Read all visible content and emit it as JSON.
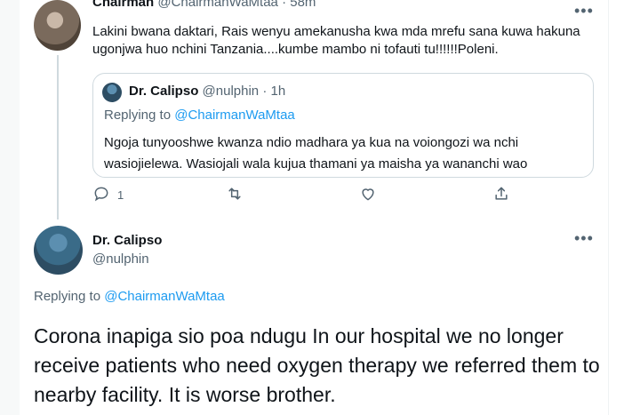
{
  "top_tweet": {
    "author_name": "Chairman",
    "author_handle": "@ChairmanWaMtaa",
    "separator": "·",
    "time": "58m",
    "text": "Lakini bwana daktari, Rais wenyu amekanusha kwa mda mrefu sana kuwa hakuna ugonjwa huo nchini Tanzania....kumbe mambo ni tofauti tu!!!!!!Poleni.",
    "more": "•••"
  },
  "quote": {
    "author_name": "Dr. Calipso",
    "author_handle": "@nulphin",
    "separator": "·",
    "time": "1h",
    "replying_prefix": "Replying to ",
    "replying_handle": "@ChairmanWaMtaa",
    "text": "Ngoja tunyooshwe kwanza ndio madhara ya kua na voiongozi wa nchi wasiojielewa. Wasiojali wala kujua thamani ya maisha ya wananchi wao"
  },
  "actions": {
    "reply_count": "1",
    "icons": [
      "reply-icon",
      "retweet-icon",
      "like-icon",
      "share-icon"
    ]
  },
  "main_tweet": {
    "author_name": "Dr. Calipso",
    "author_handle": "@nulphin",
    "replying_prefix": "Replying to ",
    "replying_handle": "@ChairmanWaMtaa",
    "text": "Corona inapiga sio poa ndugu In our hospital we no longer receive patients who need oxygen therapy we referred them to  nearby facility. It is worse brother.",
    "more": "•••"
  },
  "colors": {
    "accent": "#1d9bf0",
    "muted": "#536471",
    "border": "#cfd9de"
  }
}
